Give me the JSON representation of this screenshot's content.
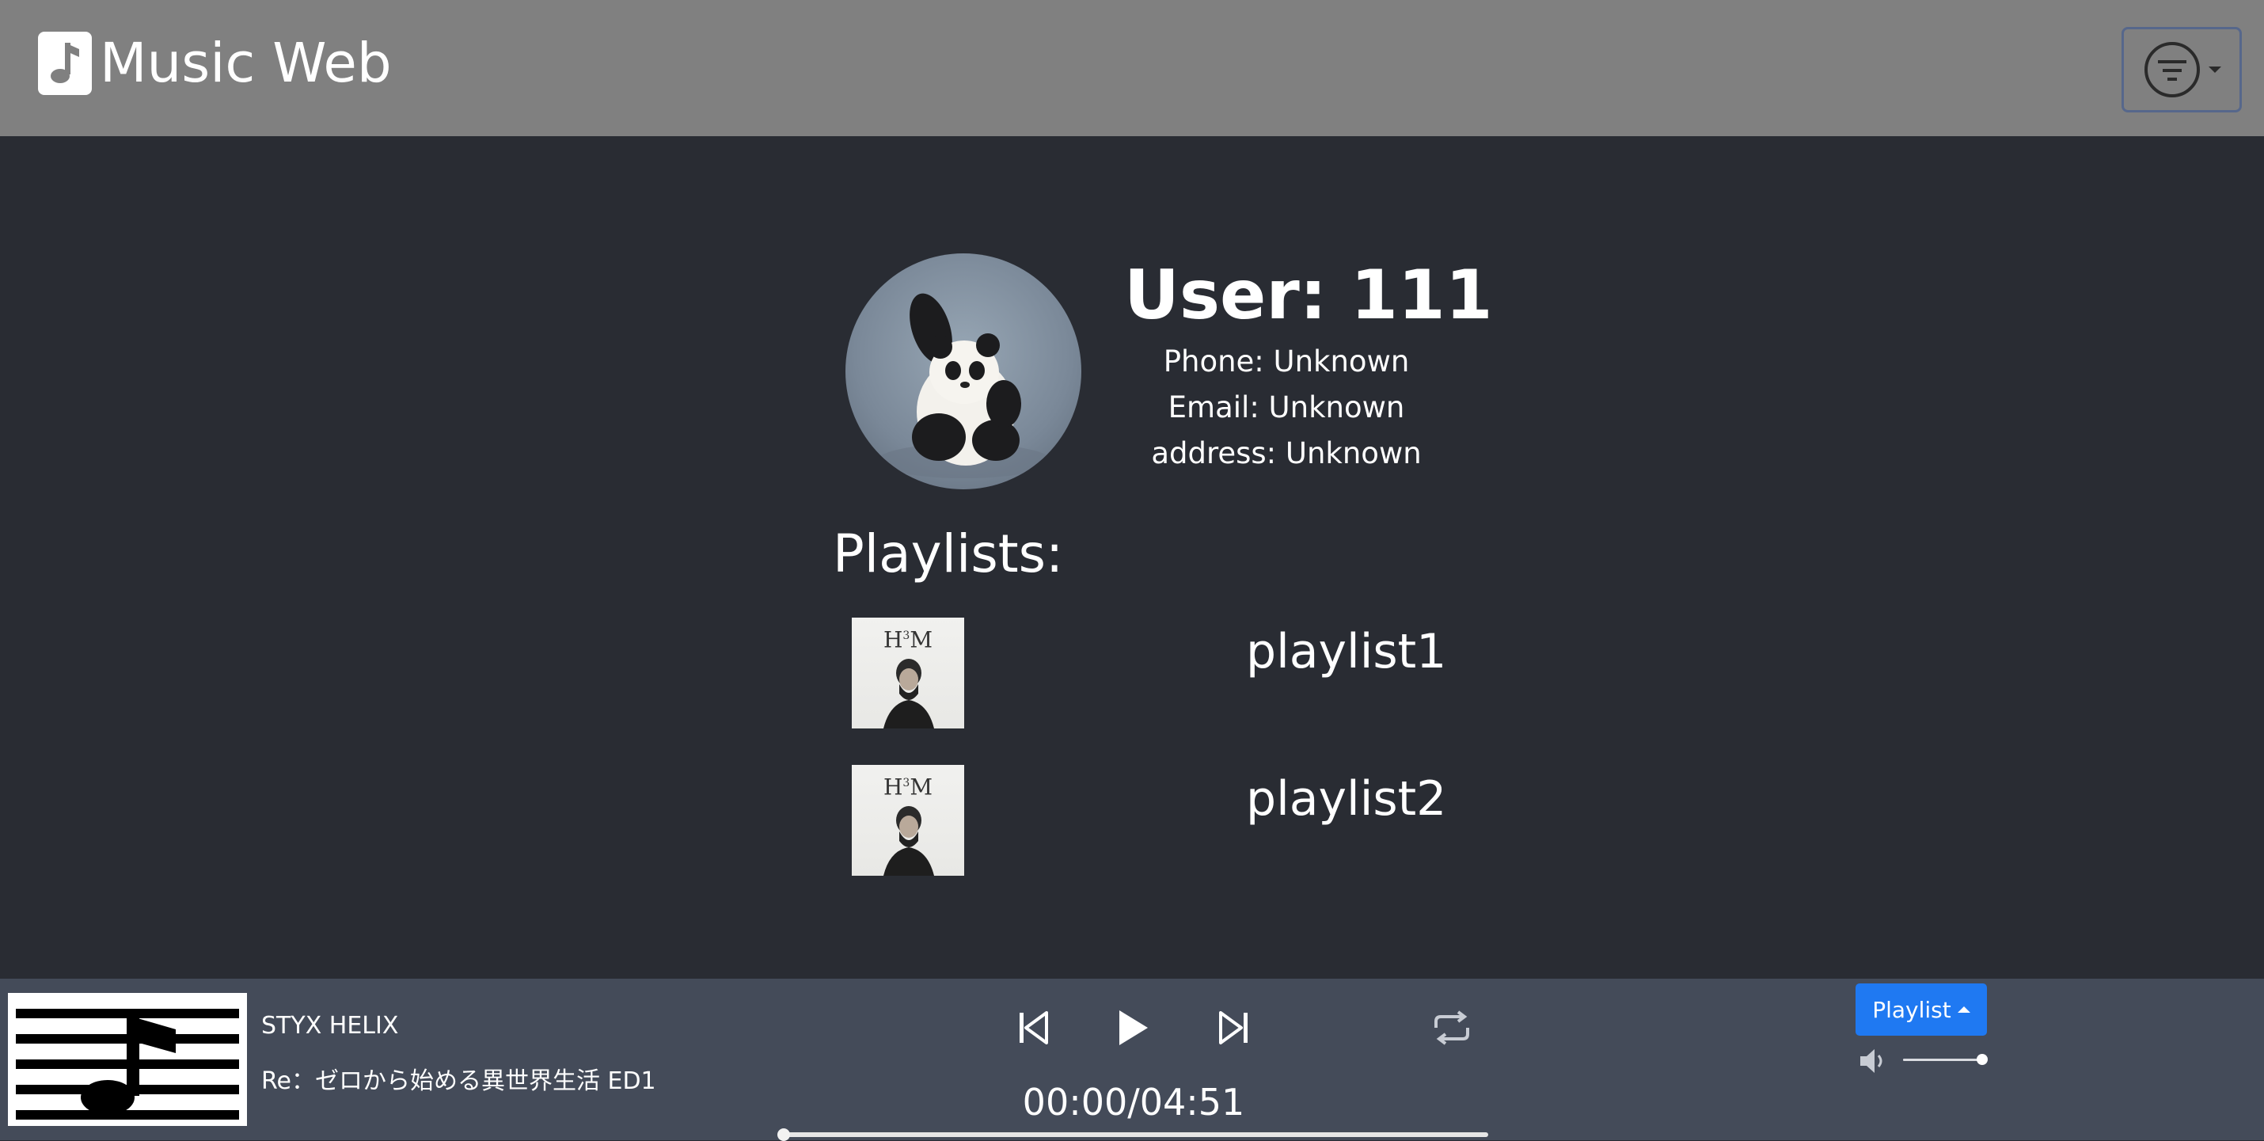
{
  "header": {
    "app_title": "Music Web",
    "logo_icon": "music-note-icon",
    "filter_icon": "filter-icon"
  },
  "profile": {
    "avatar_alt": "panda avatar",
    "user_title": "User: 111",
    "phone": "Phone: Unknown",
    "email": "Email: Unknown",
    "address": "address: Unknown"
  },
  "playlists": {
    "title": "Playlists:",
    "items": [
      {
        "name": "playlist1"
      },
      {
        "name": "playlist2"
      }
    ]
  },
  "player": {
    "song_title": "STYX HELIX",
    "song_album": "Re：ゼロから始める異世界生活 ED1",
    "time": "00:00/04:51",
    "progress_fraction": 0.0,
    "volume_fraction": 1.0,
    "playlist_button_label": "Playlist",
    "icons": [
      "previous-icon",
      "play-icon",
      "next-icon",
      "repeat-icon",
      "volume-icon"
    ]
  },
  "colors": {
    "header_bg": "#808080",
    "page_bg": "#292c33",
    "player_bg": "#444b59",
    "accent": "#1f79f2"
  }
}
